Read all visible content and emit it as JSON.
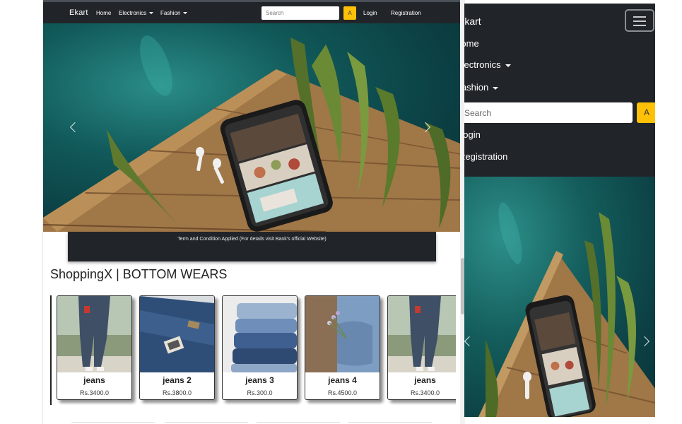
{
  "desktop": {
    "nav": {
      "brand": "Ekart",
      "home": "Home",
      "electronics": "Electronics",
      "fashion": "Fashion",
      "search_placeholder": "Search",
      "search_button": "A",
      "login": "Login",
      "registration": "Registration"
    },
    "carousel": {
      "caption": "Term and Condition Applied (For details visit Bank's official Website)"
    },
    "section_title": "ShoppingX | BOTTOM WEARS",
    "products": [
      {
        "name": "jeans",
        "price": "Rs.3400.0"
      },
      {
        "name": "jeans 2",
        "price": "Rs.3800.0"
      },
      {
        "name": "jeans 3",
        "price": "Rs.300.0"
      },
      {
        "name": "jeans 4",
        "price": "Rs.4500.0"
      },
      {
        "name": "jeans",
        "price": "Rs.3400.0"
      }
    ]
  },
  "mobile": {
    "nav": {
      "brand": "Ekart",
      "home": "Home",
      "electronics": "Electronics",
      "fashion": "Fashion",
      "search_placeholder": "Search",
      "search_button": "A",
      "login": "Login",
      "registration": "Registration"
    }
  },
  "colors": {
    "navbar": "#212529",
    "accent": "#ffc107",
    "hero_teal": "#0b4a4c"
  }
}
